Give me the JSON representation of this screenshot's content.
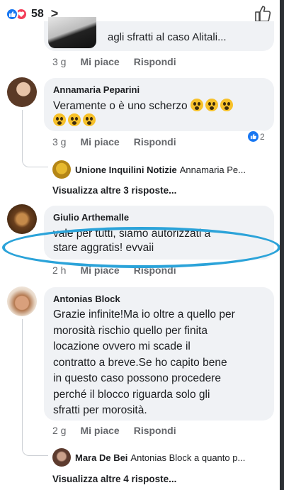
{
  "header": {
    "reaction_count": "58",
    "chevron": ">"
  },
  "comments": [
    {
      "text": "agli sfratti al caso Alitali...",
      "time": "3 g",
      "like_label": "Mi piace",
      "reply_label": "Rispondi"
    },
    {
      "name": "Annamaria Peparini",
      "text_line1": "Veramente o è uno scherzo",
      "time": "3 g",
      "like_label": "Mi piace",
      "reply_label": "Rispondi",
      "reaction_badge_count": "2",
      "reply_preview": {
        "name": "Unione Inquilini Notizie",
        "text": "Annamaria Pe..."
      },
      "more_replies": "Visualizza altre 3 risposte..."
    },
    {
      "name": "Giulio Arthemalle",
      "text_line1": "vale per tutti, siamo autorizzati a",
      "text_line2": "stare aggratis! evvaii",
      "time": "2 h",
      "like_label": "Mi piace",
      "reply_label": "Rispondi"
    },
    {
      "name": "Antonias Block",
      "lines": [
        "Grazie infinite!Ma io oltre a quello per",
        "morosità rischio quello per finita",
        "locazione ovvero mi scade il",
        "contratto a breve.Se ho capito bene",
        "in questo caso possono procedere",
        "perché il blocco riguarda solo gli",
        "sfratti per morosità."
      ],
      "time": "2 g",
      "like_label": "Mi piace",
      "reply_label": "Rispondi",
      "reply_preview": {
        "name": "Mara De Bei",
        "text": "Antonias Block a quanto p..."
      },
      "more_replies": "Visualizza altre 4 risposte..."
    }
  ],
  "colors": {
    "accent": "#1877f2",
    "love": "#f33e58",
    "highlight_ellipse": "#2ba3d9",
    "bubble": "#f0f2f5"
  }
}
